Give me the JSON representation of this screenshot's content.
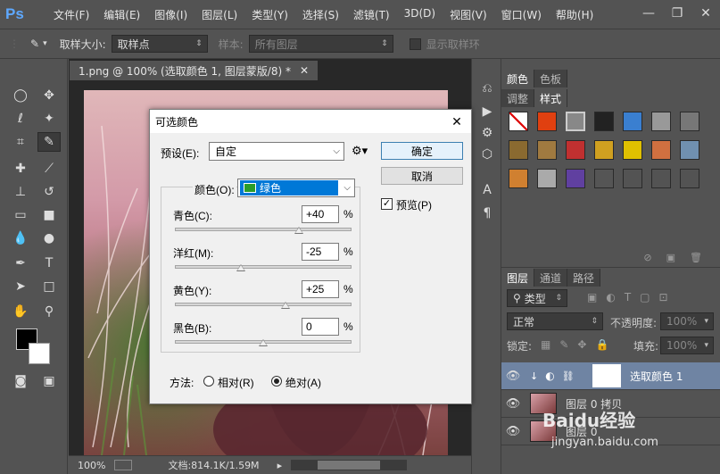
{
  "menubar": {
    "logo": "Ps",
    "items": [
      "文件(F)",
      "编辑(E)",
      "图像(I)",
      "图层(L)",
      "类型(Y)",
      "选择(S)",
      "滤镜(T)",
      "3D(D)",
      "视图(V)",
      "窗口(W)",
      "帮助(H)"
    ]
  },
  "options": {
    "sample_size_label": "取样大小:",
    "sample_size_value": "取样点",
    "sample_label": "样本:",
    "sample_value": "所有图层",
    "show_ring_label": "显示取样环"
  },
  "document": {
    "tab_title": "1.png @ 100% (选取颜色 1, 图层蒙版/8) *",
    "zoom": "100%",
    "doc_info": "文档:814.1K/1.59M"
  },
  "panels": {
    "top_tabs": [
      "颜色",
      "色板"
    ],
    "second_tabs": [
      "调整",
      "样式"
    ],
    "layer_tabs": [
      "图层",
      "通道",
      "路径"
    ],
    "kind_filter": "类型",
    "blend_mode": "正常",
    "opacity_label": "不透明度:",
    "opacity_value": "100%",
    "lock_label": "锁定:",
    "fill_label": "填充:",
    "fill_value": "100%",
    "layers": [
      {
        "name": "选取颜色 1",
        "selected": true
      },
      {
        "name": "图层 0 拷贝",
        "selected": false
      },
      {
        "name": "图层 0",
        "selected": false
      }
    ]
  },
  "dialog": {
    "title": "可选颜色",
    "preset_label": "预设(E):",
    "preset_value": "自定",
    "ok_label": "确定",
    "cancel_label": "取消",
    "preview_label": "预览(P)",
    "preview_checked": true,
    "colors_label": "颜色(O):",
    "colors_value": "绿色",
    "colors_swatch": "#2a9d2a",
    "sliders": [
      {
        "label": "青色(C):",
        "value": "+40",
        "level": 0.7
      },
      {
        "label": "洋红(M):",
        "value": "-25",
        "level": 0.375
      },
      {
        "label": "黄色(Y):",
        "value": "+25",
        "level": 0.625
      },
      {
        "label": "黑色(B):",
        "value": "0",
        "level": 0.5
      }
    ],
    "percent": "%",
    "method_label": "方法:",
    "method_options": [
      "相对(R)",
      "绝对(A)"
    ],
    "method_selected": "绝对(A)"
  },
  "watermark": {
    "brand": "Baidu经验",
    "url": "jingyan.baidu.com"
  }
}
